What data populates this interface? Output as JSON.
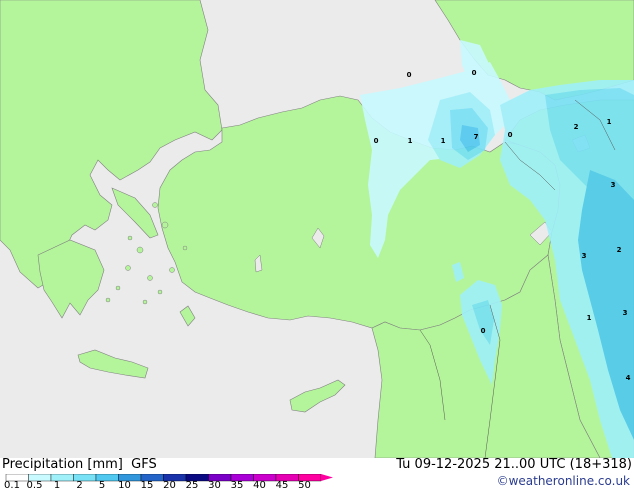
{
  "legend": {
    "title": "Precipitation [mm]  GFS",
    "ticks": [
      "0.1",
      "0.5",
      "1",
      "2",
      "5",
      "10",
      "15",
      "20",
      "25",
      "30",
      "35",
      "40",
      "45",
      "50"
    ],
    "colors": [
      "#ffffff",
      "#c8faff",
      "#a0f0fa",
      "#78e1f5",
      "#50c8f0",
      "#3296dc",
      "#2464c8",
      "#1a32aa",
      "#0a0a82",
      "#7a00c8",
      "#a800d6",
      "#cc00cc",
      "#e600b4",
      "#ff00a0"
    ]
  },
  "header": {
    "valid_time": "Tu 09-12-2025 21..00 UTC (18+318)",
    "credit": "©weatheronline.co.uk"
  },
  "map": {
    "land_color": "#b4f59b",
    "sea_color": "#ebebeb",
    "labels": [
      "0",
      "0",
      "1",
      "1",
      "7",
      "0",
      "0",
      "2",
      "1",
      "3",
      "3",
      "2",
      "0",
      "1",
      "3",
      "4"
    ]
  }
}
